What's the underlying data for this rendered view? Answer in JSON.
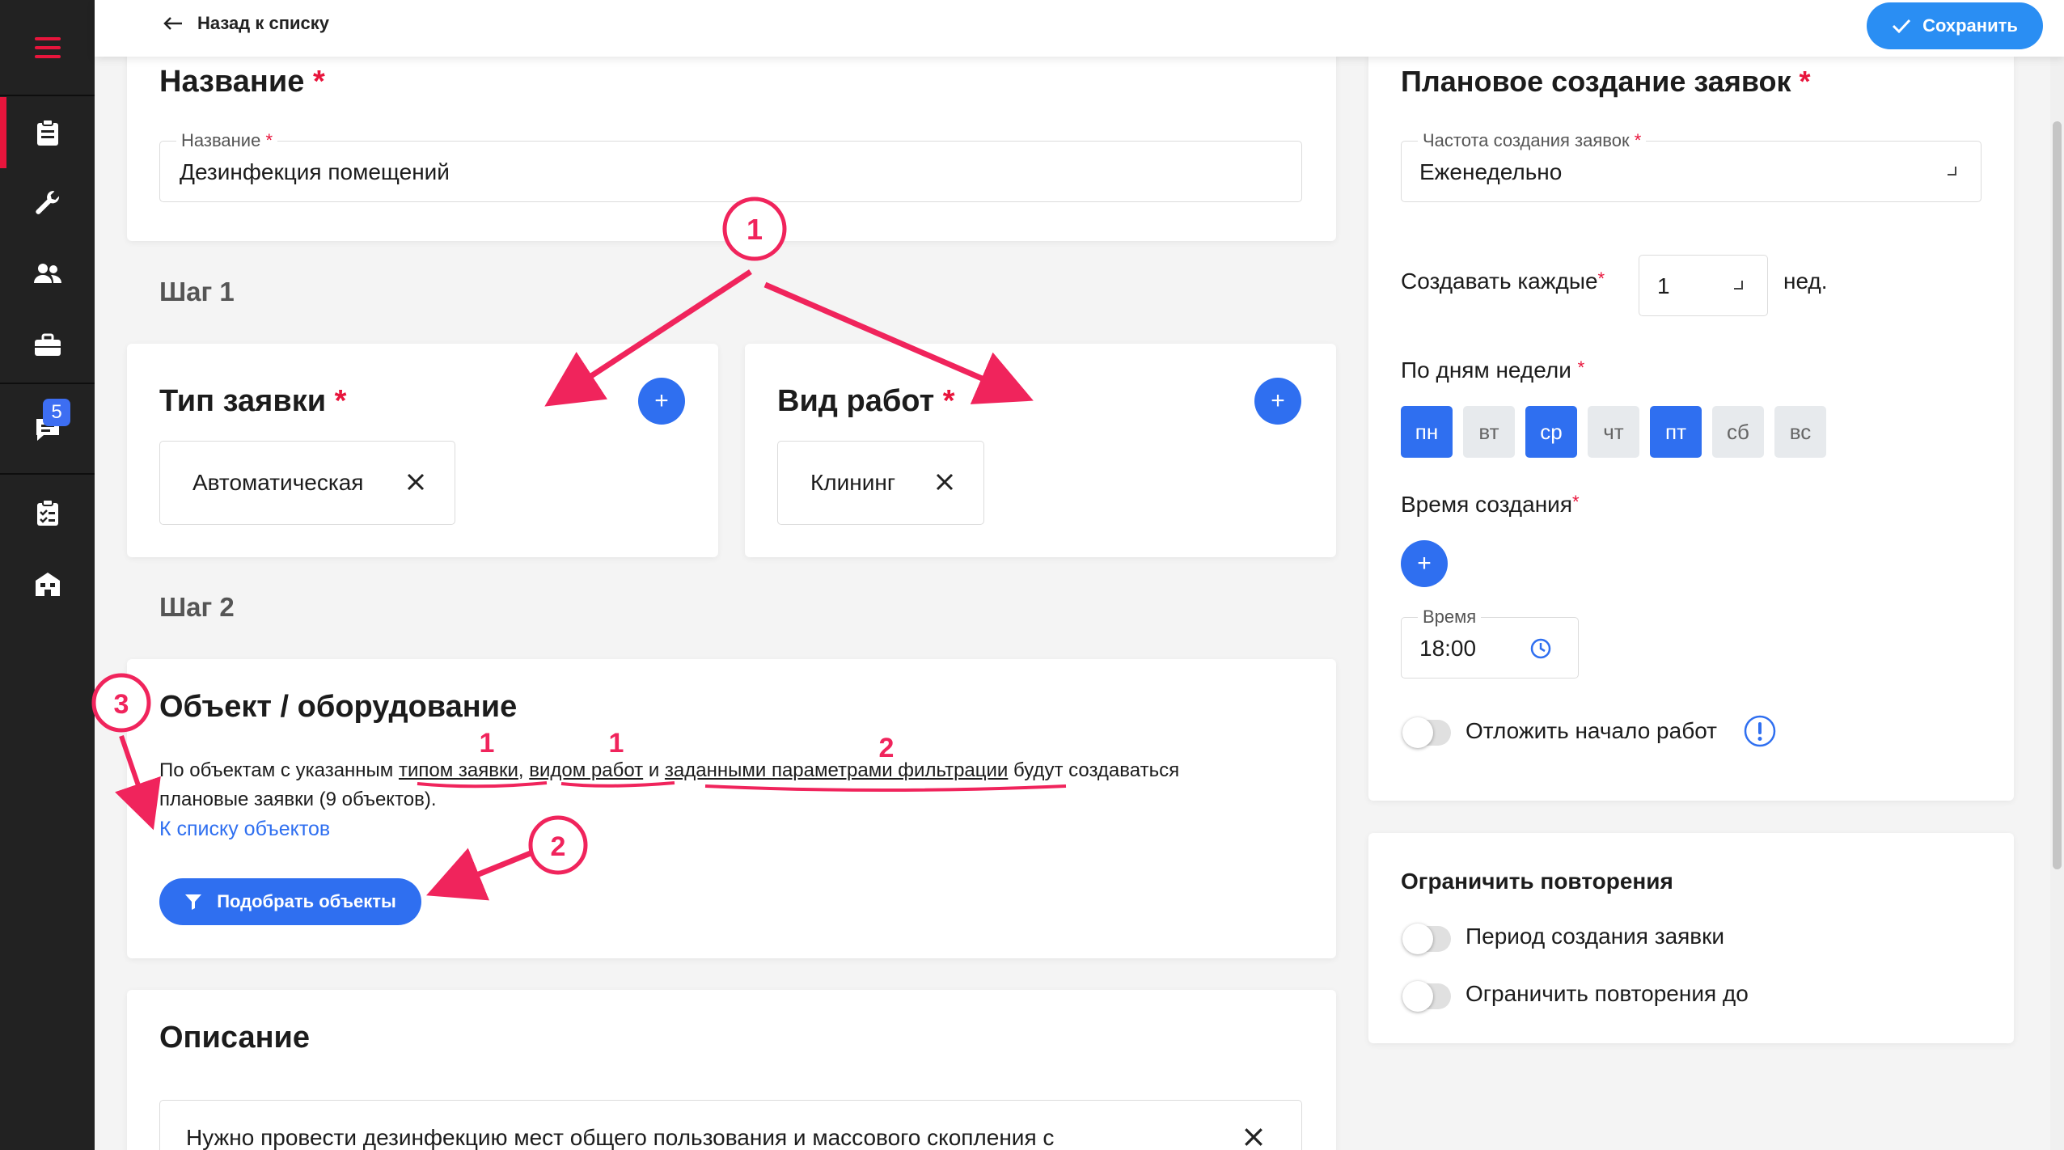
{
  "topbar": {
    "back_label": "Назад к списку",
    "save_label": "Сохранить"
  },
  "sidebar": {
    "chat_badge": "5"
  },
  "name_card": {
    "title": "Название",
    "field_label": "Название",
    "field_value": "Дезинфекция помещений"
  },
  "steps": {
    "step1": "Шаг 1",
    "step2": "Шаг 2"
  },
  "request_type": {
    "title": "Тип заявки",
    "chip": "Автоматическая"
  },
  "work_type": {
    "title": "Вид работ",
    "chip": "Клининг"
  },
  "object_card": {
    "title": "Объект / оборудование",
    "text_1": "По объектам с указанным ",
    "link_type": "типом заявки",
    "text_2": ", ",
    "link_work": "видом работ",
    "text_3": " и ",
    "link_filter": "заданными параметрами фильтрации",
    "text_4": " будут создаваться",
    "text_line2": "плановые заявки (9 объектов).",
    "list_link": "К списку объектов",
    "select_button": "Подобрать объекты"
  },
  "description_card": {
    "title": "Описание",
    "text": "Нужно провести дезинфекцию мест общего пользования и массового скопления с"
  },
  "planning": {
    "title": "Плановое создание заявок",
    "freq_label": "Частота создания заявок",
    "freq_value": "Еженедельно",
    "every_label": "Создавать каждые",
    "every_value": "1",
    "every_unit": "нед.",
    "weekdays_label": "По дням недели",
    "days": [
      {
        "label": "пн",
        "selected": true
      },
      {
        "label": "вт",
        "selected": false
      },
      {
        "label": "ср",
        "selected": true
      },
      {
        "label": "чт",
        "selected": false
      },
      {
        "label": "пт",
        "selected": true
      },
      {
        "label": "сб",
        "selected": false
      },
      {
        "label": "вс",
        "selected": false
      }
    ],
    "time_label": "Время создания",
    "time_field_label": "Время",
    "time_value": "18:00",
    "delay_label": "Отложить начало работ",
    "delay_on": false
  },
  "limits": {
    "title": "Ограничить повторения",
    "period_label": "Период создания заявки",
    "period_on": false,
    "until_label": "Ограничить повторения до",
    "until_on": false
  },
  "annotations": [
    "1",
    "1",
    "1",
    "2",
    "2",
    "3"
  ],
  "colors": {
    "accent": "#2f6ff0",
    "required": "#e8153c",
    "annotation": "#f0245c",
    "sidebar": "#222222"
  }
}
